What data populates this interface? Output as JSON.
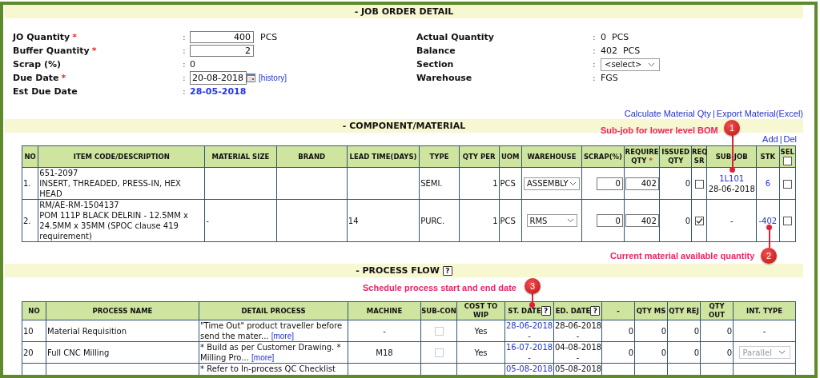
{
  "job_order_detail": {
    "title": "- JOB ORDER DETAIL",
    "left_fields": [
      {
        "kind": "input",
        "label": "JO Quantity",
        "required_mark": "*",
        "value": "400",
        "unit": "PCS"
      },
      {
        "kind": "input",
        "label": "Buffer Quantity",
        "required_mark": "*",
        "value": "2"
      },
      {
        "kind": "text",
        "label": "Scrap (%)",
        "value": "0"
      },
      {
        "kind": "date",
        "label": "Due Date",
        "required_mark": "*",
        "value": "20-08-2018",
        "link": "[history]"
      },
      {
        "kind": "highlight",
        "label": "Est Due Date",
        "value": "28-05-2018"
      }
    ],
    "right_fields": [
      {
        "kind": "text",
        "label": "Actual Quantity",
        "value": "0  PCS"
      },
      {
        "kind": "text",
        "label": "Balance",
        "value": "402  PCS"
      },
      {
        "kind": "select",
        "label": "Section",
        "value": "<select>"
      },
      {
        "kind": "text",
        "label": "Warehouse",
        "value": "FGS"
      }
    ],
    "colon": ":"
  },
  "links": {
    "items": [
      "Calculate Material Qty",
      "Export Material(Excel)"
    ],
    "separator": "|"
  },
  "component": {
    "title": "- COMPONENT/MATERIAL",
    "actions": [
      "Add",
      "Del"
    ],
    "separator": "|",
    "columns": [
      {
        "label": "NO"
      },
      {
        "label": "ITEM CODE/DESCRIPTION"
      },
      {
        "label": "MATERIAL SIZE"
      },
      {
        "label": "BRAND"
      },
      {
        "label": "LEAD TIME(DAYS)"
      },
      {
        "label": "TYPE"
      },
      {
        "label": "QTY PER"
      },
      {
        "label": "UOM"
      },
      {
        "label": "WAREHOUSE"
      },
      {
        "label": "SCRAP(%)"
      },
      {
        "label": "REQUIRE QTY",
        "required_mark": "*"
      },
      {
        "label": "ISSUED QTY"
      },
      {
        "label": "REQ SR"
      },
      {
        "label": "SUB-JOB"
      },
      {
        "label": "STK"
      },
      {
        "label": "SEL",
        "checked": false
      }
    ],
    "rows": [
      {
        "no": "1.",
        "item_code": "651-2097",
        "description": "INSERT, THREADED, PRESS-IN, HEX HEAD",
        "material_size": "",
        "brand": "",
        "lead_time": "",
        "type": "SEMI.",
        "qty_per": "1",
        "uom": "PCS",
        "warehouse": "ASSEMBLY",
        "scrap": "0",
        "require_qty": "402",
        "issued_qty": "0",
        "req_sr": false,
        "sub_job": {
          "code": "1L101",
          "date": "28-06-2018"
        },
        "stk": "6",
        "selected": false
      },
      {
        "no": "2.",
        "item_code": "RM/AE-RM-1504137",
        "description": "POM 111P BLACK DELRIN - 12.5MM x 24.5MM x 35MM (SPOC clause 419 requirement)",
        "material_size": "-",
        "brand": "",
        "lead_time": "14",
        "type": "PURC.",
        "qty_per": "1",
        "uom": "PCS",
        "warehouse": "RMS",
        "scrap": "0",
        "require_qty": "402",
        "issued_qty": "0",
        "req_sr": true,
        "sub_job_text": "-",
        "stk": "-402",
        "selected": false
      }
    ]
  },
  "process": {
    "title": "- PROCESS FLOW",
    "help_mark": "?",
    "columns": [
      {
        "label": "NO"
      },
      {
        "label": "PROCESS NAME"
      },
      {
        "label": "DETAIL PROCESS"
      },
      {
        "label": "MACHINE"
      },
      {
        "label": "SUB-CON"
      },
      {
        "label": "COST TO WIP"
      },
      {
        "label": "ST. DATE",
        "help_mark": "?"
      },
      {
        "label": "ED. DATE",
        "help_mark": "?"
      },
      {
        "label": "-"
      },
      {
        "label": "QTY MS"
      },
      {
        "label": "QTY REJ"
      },
      {
        "label": "QTY OUT"
      },
      {
        "label": "INT. TYPE"
      }
    ],
    "rows": [
      {
        "no": "10",
        "name": "Material Requisition",
        "detail": "\"Time Out\" product traveller before send the mater...",
        "more": "[more]",
        "machine": "-",
        "sub_con": false,
        "cost_to_wip": "Yes",
        "st_date": "28-06-2018",
        "st_sep": "-",
        "ed_date": "28-06-2018",
        "ed_sep": "-",
        "col_9": "0",
        "qty_ms": "0",
        "qty_rej": "0",
        "qty_out": "0",
        "int_type": {
          "kind": "text",
          "value": "-"
        }
      },
      {
        "no": "20",
        "name": "Full CNC Milling",
        "detail": "* Build as per Customer Drawing. * Milling Pro...",
        "more": "[more]",
        "machine": "M18",
        "sub_con": false,
        "cost_to_wip": "Yes",
        "st_date": "16-07-2018",
        "st_sep": "-",
        "ed_date": "04-08-2018",
        "ed_sep": "-",
        "col_9": "0",
        "qty_ms": "0",
        "qty_rej": "0",
        "qty_out": "0",
        "int_type": {
          "kind": "select",
          "value": "Parallel"
        }
      },
      {
        "detail": "* Refer to In-process QC Checklist",
        "st_date": "05-08-2018",
        "ed_date": "05-08-2018"
      }
    ]
  },
  "callouts": [
    {
      "number": "1",
      "text": "Sub-job for lower level BOM"
    },
    {
      "number": "2",
      "text": "Current material available quantity"
    },
    {
      "number": "3",
      "text": "Schedule process start and end date"
    }
  ]
}
